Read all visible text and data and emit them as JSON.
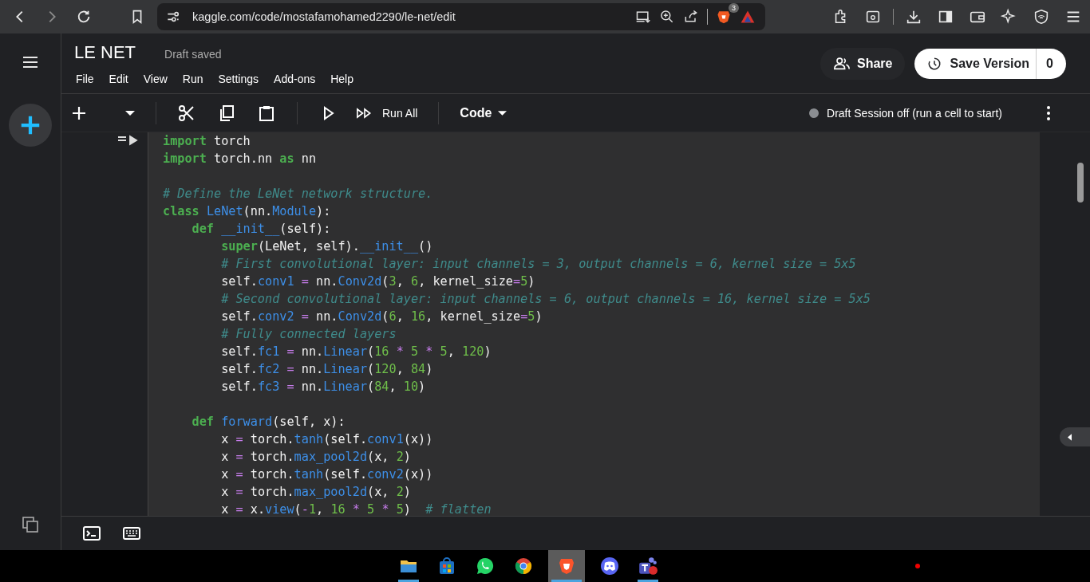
{
  "browser": {
    "url": "kaggle.com/code/mostafamohamed2290/le-net/edit",
    "extension_badge": "3"
  },
  "notebook": {
    "title": "LE NET",
    "status": "Draft saved",
    "menu": [
      "File",
      "Edit",
      "View",
      "Run",
      "Settings",
      "Add-ons",
      "Help"
    ],
    "share_label": "Share",
    "save_label": "Save Version",
    "save_count": "0"
  },
  "toolbar": {
    "run_all_label": "Run All",
    "cell_type": "Code",
    "session_status": "Draft Session off (run a cell to start)"
  },
  "code_lines": [
    {
      "tokens": [
        {
          "text": "import",
          "kind": "keyword"
        },
        {
          "text": " torch",
          "kind": "plain"
        }
      ]
    },
    {
      "tokens": [
        {
          "text": "import",
          "kind": "keyword"
        },
        {
          "text": " torch.nn ",
          "kind": "plain"
        },
        {
          "text": "as",
          "kind": "keyword"
        },
        {
          "text": " nn",
          "kind": "plain"
        }
      ]
    },
    {
      "kind": "blank"
    },
    {
      "tokens": [
        {
          "text": "# Define the LeNet network structure.",
          "kind": "comment"
        }
      ]
    },
    {
      "tokens": [
        {
          "text": "class ",
          "kind": "keyword"
        },
        {
          "text": "LeNet",
          "kind": "name"
        },
        {
          "text": "(nn.",
          "kind": "plain"
        },
        {
          "text": "Module",
          "kind": "name"
        },
        {
          "text": "):",
          "kind": "plain"
        }
      ]
    },
    {
      "tokens": [
        {
          "text": "    def ",
          "kind": "keyword"
        },
        {
          "text": "__init__",
          "kind": "name"
        },
        {
          "text": "(self):",
          "kind": "plain"
        }
      ]
    },
    {
      "tokens": [
        {
          "text": "        super",
          "kind": "keyword"
        },
        {
          "text": "(LeNet, self).",
          "kind": "plain"
        },
        {
          "text": "__init__",
          "kind": "name"
        },
        {
          "text": "()",
          "kind": "plain"
        }
      ]
    },
    {
      "tokens": [
        {
          "text": "        # First convolutional layer: input channels = 3, output channels = 6, kernel size = 5x5",
          "kind": "comment"
        }
      ]
    },
    {
      "tokens": [
        {
          "text": "        self.",
          "kind": "plain"
        },
        {
          "text": "conv1 ",
          "kind": "name"
        },
        {
          "text": "=",
          "kind": "op"
        },
        {
          "text": " nn.",
          "kind": "plain"
        },
        {
          "text": "Conv2d",
          "kind": "name"
        },
        {
          "text": "(",
          "kind": "plain"
        },
        {
          "text": "3",
          "kind": "number"
        },
        {
          "text": ", ",
          "kind": "plain"
        },
        {
          "text": "6",
          "kind": "number"
        },
        {
          "text": ", kernel_size",
          "kind": "plain"
        },
        {
          "text": "=",
          "kind": "op"
        },
        {
          "text": "5",
          "kind": "number"
        },
        {
          "text": ")",
          "kind": "plain"
        }
      ]
    },
    {
      "tokens": [
        {
          "text": "        # Second convolutional layer: input channels = 6, output channels = 16, kernel size = 5x5",
          "kind": "comment"
        }
      ]
    },
    {
      "tokens": [
        {
          "text": "        self.",
          "kind": "plain"
        },
        {
          "text": "conv2 ",
          "kind": "name"
        },
        {
          "text": "=",
          "kind": "op"
        },
        {
          "text": " nn.",
          "kind": "plain"
        },
        {
          "text": "Conv2d",
          "kind": "name"
        },
        {
          "text": "(",
          "kind": "plain"
        },
        {
          "text": "6",
          "kind": "number"
        },
        {
          "text": ", ",
          "kind": "plain"
        },
        {
          "text": "16",
          "kind": "number"
        },
        {
          "text": ", kernel_size",
          "kind": "plain"
        },
        {
          "text": "=",
          "kind": "op"
        },
        {
          "text": "5",
          "kind": "number"
        },
        {
          "text": ")",
          "kind": "plain"
        }
      ]
    },
    {
      "tokens": [
        {
          "text": "        # Fully connected layers",
          "kind": "comment"
        }
      ]
    },
    {
      "tokens": [
        {
          "text": "        self.",
          "kind": "plain"
        },
        {
          "text": "fc1 ",
          "kind": "name"
        },
        {
          "text": "=",
          "kind": "op"
        },
        {
          "text": " nn.",
          "kind": "plain"
        },
        {
          "text": "Linear",
          "kind": "name"
        },
        {
          "text": "(",
          "kind": "plain"
        },
        {
          "text": "16 ",
          "kind": "number"
        },
        {
          "text": "*",
          "kind": "op"
        },
        {
          "text": " 5 ",
          "kind": "number"
        },
        {
          "text": "*",
          "kind": "op"
        },
        {
          "text": " 5",
          "kind": "number"
        },
        {
          "text": ", ",
          "kind": "plain"
        },
        {
          "text": "120",
          "kind": "number"
        },
        {
          "text": ")",
          "kind": "plain"
        }
      ]
    },
    {
      "tokens": [
        {
          "text": "        self.",
          "kind": "plain"
        },
        {
          "text": "fc2 ",
          "kind": "name"
        },
        {
          "text": "=",
          "kind": "op"
        },
        {
          "text": " nn.",
          "kind": "plain"
        },
        {
          "text": "Linear",
          "kind": "name"
        },
        {
          "text": "(",
          "kind": "plain"
        },
        {
          "text": "120",
          "kind": "number"
        },
        {
          "text": ", ",
          "kind": "plain"
        },
        {
          "text": "84",
          "kind": "number"
        },
        {
          "text": ")",
          "kind": "plain"
        }
      ]
    },
    {
      "tokens": [
        {
          "text": "        self.",
          "kind": "plain"
        },
        {
          "text": "fc3 ",
          "kind": "name"
        },
        {
          "text": "=",
          "kind": "op"
        },
        {
          "text": " nn.",
          "kind": "plain"
        },
        {
          "text": "Linear",
          "kind": "name"
        },
        {
          "text": "(",
          "kind": "plain"
        },
        {
          "text": "84",
          "kind": "number"
        },
        {
          "text": ", ",
          "kind": "plain"
        },
        {
          "text": "10",
          "kind": "number"
        },
        {
          "text": ")",
          "kind": "plain"
        }
      ]
    },
    {
      "kind": "blank"
    },
    {
      "tokens": [
        {
          "text": "    def ",
          "kind": "keyword"
        },
        {
          "text": "forward",
          "kind": "name"
        },
        {
          "text": "(self, x):",
          "kind": "plain"
        }
      ]
    },
    {
      "tokens": [
        {
          "text": "        x ",
          "kind": "plain"
        },
        {
          "text": "=",
          "kind": "op"
        },
        {
          "text": " torch.",
          "kind": "plain"
        },
        {
          "text": "tanh",
          "kind": "name"
        },
        {
          "text": "(self.",
          "kind": "plain"
        },
        {
          "text": "conv1",
          "kind": "name"
        },
        {
          "text": "(x))",
          "kind": "plain"
        }
      ]
    },
    {
      "tokens": [
        {
          "text": "        x ",
          "kind": "plain"
        },
        {
          "text": "=",
          "kind": "op"
        },
        {
          "text": " torch.",
          "kind": "plain"
        },
        {
          "text": "max_pool2d",
          "kind": "name"
        },
        {
          "text": "(x, ",
          "kind": "plain"
        },
        {
          "text": "2",
          "kind": "number"
        },
        {
          "text": ")",
          "kind": "plain"
        }
      ]
    },
    {
      "tokens": [
        {
          "text": "        x ",
          "kind": "plain"
        },
        {
          "text": "=",
          "kind": "op"
        },
        {
          "text": " torch.",
          "kind": "plain"
        },
        {
          "text": "tanh",
          "kind": "name"
        },
        {
          "text": "(self.",
          "kind": "plain"
        },
        {
          "text": "conv2",
          "kind": "name"
        },
        {
          "text": "(x))",
          "kind": "plain"
        }
      ]
    },
    {
      "tokens": [
        {
          "text": "        x ",
          "kind": "plain"
        },
        {
          "text": "=",
          "kind": "op"
        },
        {
          "text": " torch.",
          "kind": "plain"
        },
        {
          "text": "max_pool2d",
          "kind": "name"
        },
        {
          "text": "(x, ",
          "kind": "plain"
        },
        {
          "text": "2",
          "kind": "number"
        },
        {
          "text": ")",
          "kind": "plain"
        }
      ]
    },
    {
      "tokens": [
        {
          "text": "        x ",
          "kind": "plain"
        },
        {
          "text": "=",
          "kind": "op"
        },
        {
          "text": " x.",
          "kind": "plain"
        },
        {
          "text": "view",
          "kind": "name"
        },
        {
          "text": "(",
          "kind": "plain"
        },
        {
          "text": "-",
          "kind": "op"
        },
        {
          "text": "1",
          "kind": "number"
        },
        {
          "text": ", ",
          "kind": "plain"
        },
        {
          "text": "16 ",
          "kind": "number"
        },
        {
          "text": "*",
          "kind": "op"
        },
        {
          "text": " 5 ",
          "kind": "number"
        },
        {
          "text": "*",
          "kind": "op"
        },
        {
          "text": " 5",
          "kind": "number"
        },
        {
          "text": ")  ",
          "kind": "plain"
        },
        {
          "text": "# flatten",
          "kind": "comment"
        }
      ]
    }
  ],
  "taskbar": [
    {
      "kind": "folder",
      "open": true,
      "selected": false
    },
    {
      "kind": "store",
      "open": false,
      "selected": false
    },
    {
      "kind": "chat",
      "open": false,
      "selected": false
    },
    {
      "kind": "chrome",
      "open": false,
      "selected": false
    },
    {
      "kind": "lion",
      "open": true,
      "selected": true
    },
    {
      "kind": "controller",
      "open": false,
      "selected": false
    },
    {
      "kind": "team",
      "open": true,
      "selected": false
    }
  ]
}
